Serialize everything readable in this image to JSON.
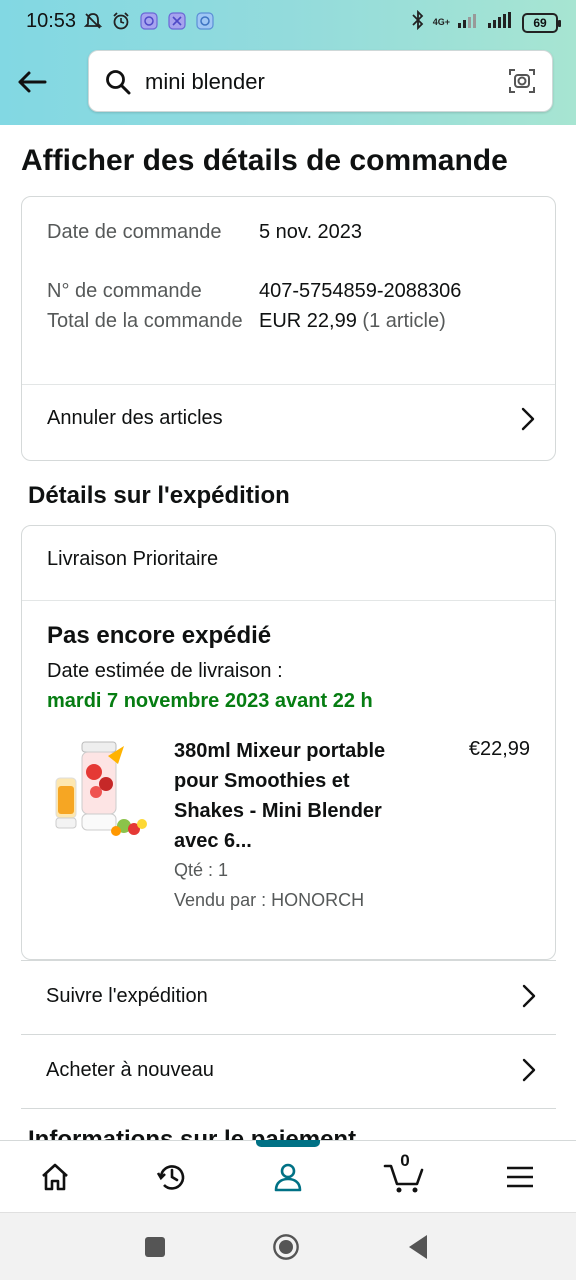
{
  "status_bar": {
    "time": "10:53",
    "network": "4G+",
    "battery": "69"
  },
  "header": {
    "search_value": "mini blender",
    "icons": [
      "back-arrow-icon",
      "search-icon",
      "camera-icon"
    ]
  },
  "page": {
    "title": "Afficher des détails de commande"
  },
  "order_summary": {
    "date_label": "Date de commande",
    "date_value": "5 nov. 2023",
    "number_label": "N° de commande",
    "number_value": "407-5754859-2088306",
    "total_label": "Total de la commande",
    "total_value": "EUR 22,99",
    "total_items": "(1 article)",
    "cancel_link": "Annuler des articles"
  },
  "shipping": {
    "section_title": "Détails sur l'expédition",
    "type": "Livraison Prioritaire",
    "status": "Pas encore expédié",
    "eta_label": "Date estimée de livraison :",
    "eta_date": "mardi 7 novembre 2023 avant 22 h",
    "product": {
      "title": "380ml Mixeur portable pour Smoothies et Shakes - Mini Blender avec 6...",
      "price": "€22,99",
      "qty": "Qté : 1",
      "seller": "Vendu par : HONORCH"
    }
  },
  "actions": {
    "track": "Suivre l'expédition",
    "buy_again": "Acheter à nouveau"
  },
  "partial_section": "Informations sur le paiement",
  "bottom_nav": {
    "items": [
      "home-icon",
      "history-icon",
      "account-icon",
      "cart-icon",
      "menu-icon"
    ],
    "active": "account-icon",
    "cart_count": "0",
    "accent": "#007185"
  },
  "colors": {
    "eta_green": "#067d12",
    "muted_text": "#565959",
    "header_gradient_start": "#82d8e3",
    "header_gradient_end": "#a7e5d2"
  }
}
